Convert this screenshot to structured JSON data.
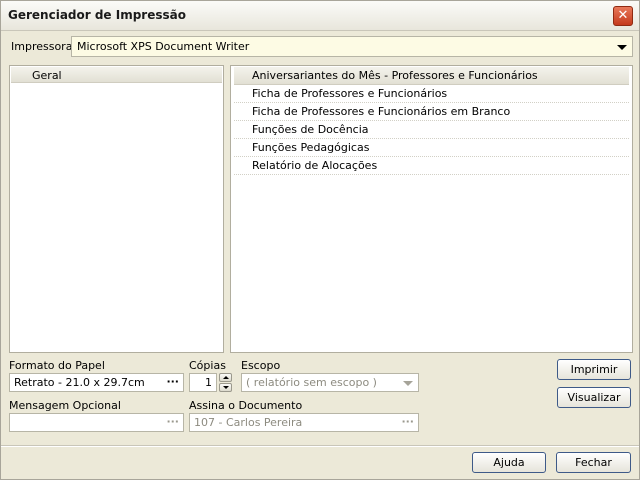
{
  "window": {
    "title": "Gerenciador de Impressão",
    "close_symbol": "✕"
  },
  "printer": {
    "label": "Impressora",
    "value": "Microsoft XPS Document Writer"
  },
  "categories": {
    "header": "Geral"
  },
  "reports": {
    "items": [
      "Aniversariantes do Mês - Professores e Funcionários",
      "Ficha de Professores e Funcionários",
      "Ficha de Professores e Funcionários em Branco",
      "Funções de Docência",
      "Funções Pedagógicas",
      "Relatório de Alocações"
    ]
  },
  "paper": {
    "label": "Formato do Papel",
    "value": "Retrato - 21.0 x 29.7cm",
    "ellipsis": "···"
  },
  "copies": {
    "label": "Cópias",
    "value": "1"
  },
  "scope": {
    "label": "Escopo",
    "placeholder": "( relatório sem escopo )"
  },
  "message": {
    "label": "Mensagem Opcional",
    "value": "",
    "ellipsis": "···"
  },
  "signer": {
    "label": "Assina o Documento",
    "value": "107 - Carlos Pereira",
    "ellipsis": "···"
  },
  "buttons": {
    "print": "Imprimir",
    "preview": "Visualizar",
    "help": "Ajuda",
    "close": "Fechar"
  }
}
